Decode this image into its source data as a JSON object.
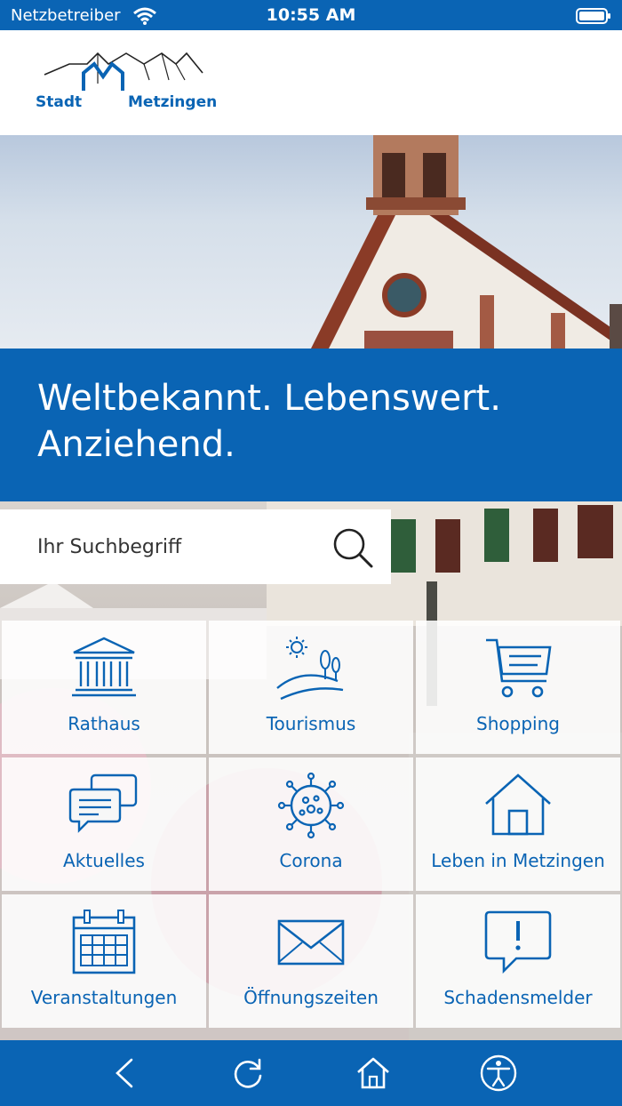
{
  "status_bar": {
    "carrier": "Netzbetreiber",
    "time": "10:55 AM"
  },
  "logo": {
    "left": "Stadt",
    "right": "Metzingen"
  },
  "banner": {
    "line1": "Weltbekannt. Lebenswert.",
    "line2": "Anziehend."
  },
  "search": {
    "placeholder": "Ihr Suchbegriff"
  },
  "tiles": [
    {
      "label": "Rathaus",
      "icon": "town-hall-icon"
    },
    {
      "label": "Tourismus",
      "icon": "landscape-icon"
    },
    {
      "label": "Shopping",
      "icon": "cart-icon"
    },
    {
      "label": "Aktuelles",
      "icon": "chat-bubbles-icon"
    },
    {
      "label": "Corona",
      "icon": "virus-icon"
    },
    {
      "label": "Leben in Metzingen",
      "icon": "house-icon"
    },
    {
      "label": "Veranstaltungen",
      "icon": "calendar-icon"
    },
    {
      "label": "Öffnungszeiten",
      "icon": "envelope-icon"
    },
    {
      "label": "Schadensmelder",
      "icon": "alert-bubble-icon"
    }
  ],
  "bottom_nav": [
    "back-icon",
    "reload-icon",
    "home-icon",
    "accessibility-icon"
  ],
  "colors": {
    "accent": "#0a64b4"
  }
}
